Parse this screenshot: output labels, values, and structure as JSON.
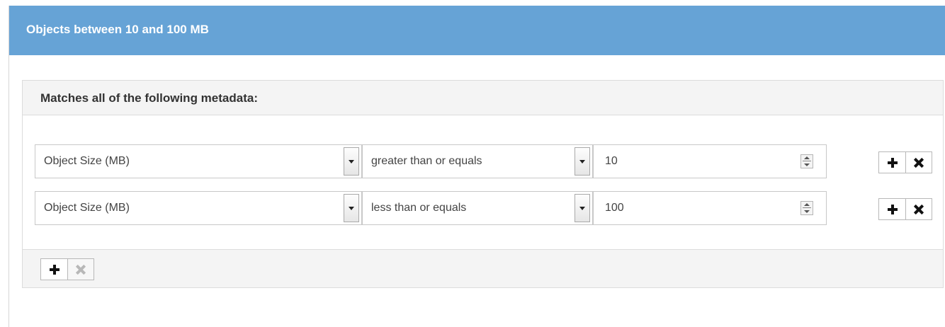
{
  "panel": {
    "title": "Objects between 10 and 100 MB"
  },
  "group": {
    "title": "Matches all of the following metadata:"
  },
  "rows": [
    {
      "field": "Object Size (MB)",
      "operator": "greater than or equals",
      "value": "10"
    },
    {
      "field": "Object Size (MB)",
      "operator": "less than or equals",
      "value": "100"
    }
  ],
  "icons": {
    "add": "plus-icon",
    "remove": "x-icon",
    "dropdown": "chevron-down-icon",
    "spinner": "spinner-icon"
  },
  "colors": {
    "header_bg": "#66a3d6",
    "header_text": "#ffffff",
    "group_header_bg": "#f4f4f4"
  }
}
